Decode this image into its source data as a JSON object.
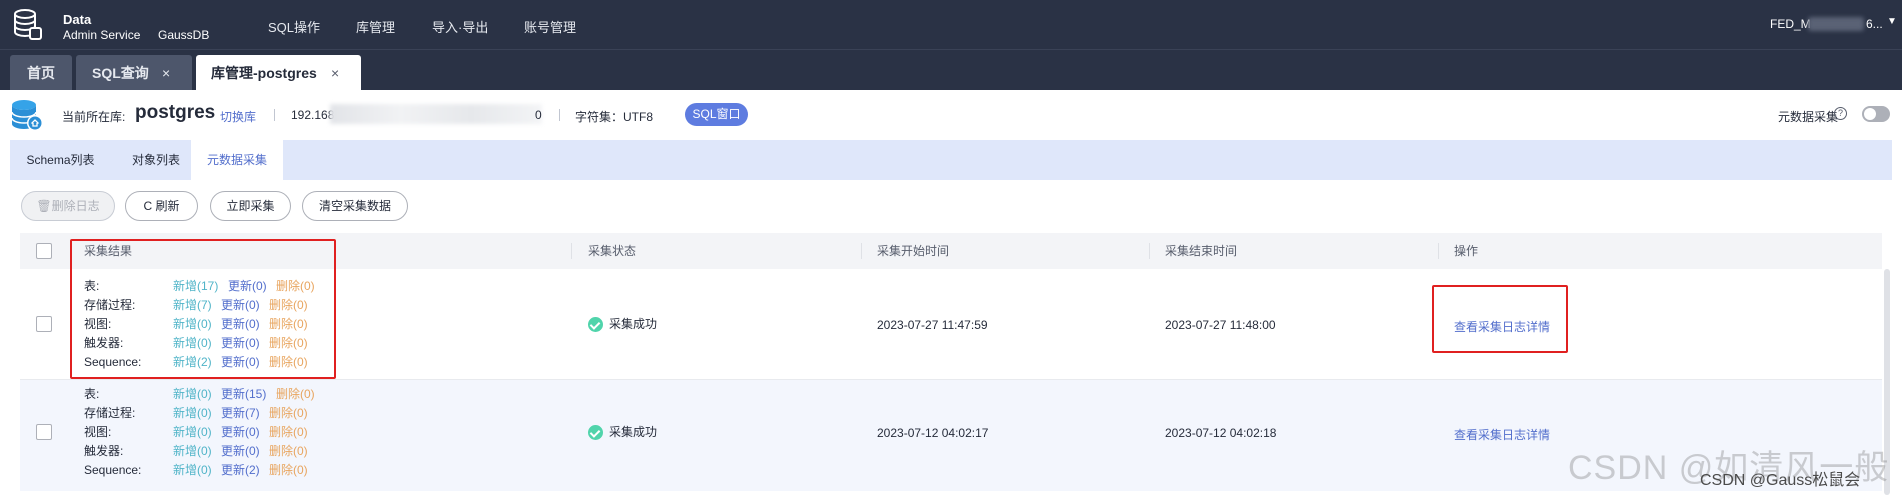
{
  "brand": {
    "line1": "Data",
    "line2": "Admin Service",
    "product": "GaussDB"
  },
  "nav": {
    "items": [
      {
        "label": "SQL操作"
      },
      {
        "label": "库管理"
      },
      {
        "label": "导入·导出"
      },
      {
        "label": "账号管理"
      }
    ]
  },
  "user": {
    "name_prefix": "FED_M",
    "name_suffix": "6..."
  },
  "window_tabs": [
    {
      "label": "首页"
    },
    {
      "label": "SQL查询"
    },
    {
      "label": "库管理-postgres"
    }
  ],
  "info": {
    "current_db_label": "当前所在库:",
    "current_db": "postgres",
    "switch_db": "切换库",
    "ip_prefix": "192.168",
    "ip_suffix": "0",
    "charset": "字符集：UTF8",
    "sql_window": "SQL窗口",
    "metadata_collect_label": "元数据采集"
  },
  "sub_tabs": [
    {
      "label": "Schema列表"
    },
    {
      "label": "对象列表"
    },
    {
      "label": "元数据采集",
      "active": true
    }
  ],
  "toolbar": {
    "delete_log": "删除日志",
    "refresh": "刷新",
    "collect_now": "立即采集",
    "clear_data": "清空采集数据"
  },
  "table": {
    "headers": [
      "采集结果",
      "采集状态",
      "采集开始时间",
      "采集结束时间",
      "操作"
    ],
    "rows": [
      {
        "results": [
          {
            "label": "表:",
            "add": "新增(17)",
            "update": "更新(0)",
            "delete": "删除(0)"
          },
          {
            "label": "存储过程:",
            "add": "新增(7)",
            "update": "更新(0)",
            "delete": "删除(0)"
          },
          {
            "label": "视图:",
            "add": "新增(0)",
            "update": "更新(0)",
            "delete": "删除(0)"
          },
          {
            "label": "触发器:",
            "add": "新增(0)",
            "update": "更新(0)",
            "delete": "删除(0)"
          },
          {
            "label": "Sequence:",
            "add": "新增(2)",
            "update": "更新(0)",
            "delete": "删除(0)"
          }
        ],
        "status": "采集成功",
        "start": "2023-07-27 11:47:59",
        "end": "2023-07-27 11:48:00",
        "action": "查看采集日志详情"
      },
      {
        "results": [
          {
            "label": "表:",
            "add": "新增(0)",
            "update": "更新(15)",
            "delete": "删除(0)"
          },
          {
            "label": "存储过程:",
            "add": "新增(0)",
            "update": "更新(7)",
            "delete": "删除(0)"
          },
          {
            "label": "视图:",
            "add": "新增(0)",
            "update": "更新(0)",
            "delete": "删除(0)"
          },
          {
            "label": "触发器:",
            "add": "新增(0)",
            "update": "更新(0)",
            "delete": "删除(0)"
          },
          {
            "label": "Sequence:",
            "add": "新增(0)",
            "update": "更新(2)",
            "delete": "删除(0)"
          }
        ],
        "status": "采集成功",
        "start": "2023-07-12 04:02:17",
        "end": "2023-07-12 04:02:18",
        "action": "查看采集日志详情"
      }
    ]
  },
  "watermarks": {
    "large": "CSDN @如清风一般",
    "small": "CSDN @Gauss松鼠会"
  },
  "colors": {
    "topbar": "#2a3245",
    "accent": "#5e7ce0",
    "link": "#526ecc",
    "add": "#50b4c8",
    "delete": "#e8a55f",
    "success": "#50d4ab",
    "highlight": "#e02020"
  }
}
